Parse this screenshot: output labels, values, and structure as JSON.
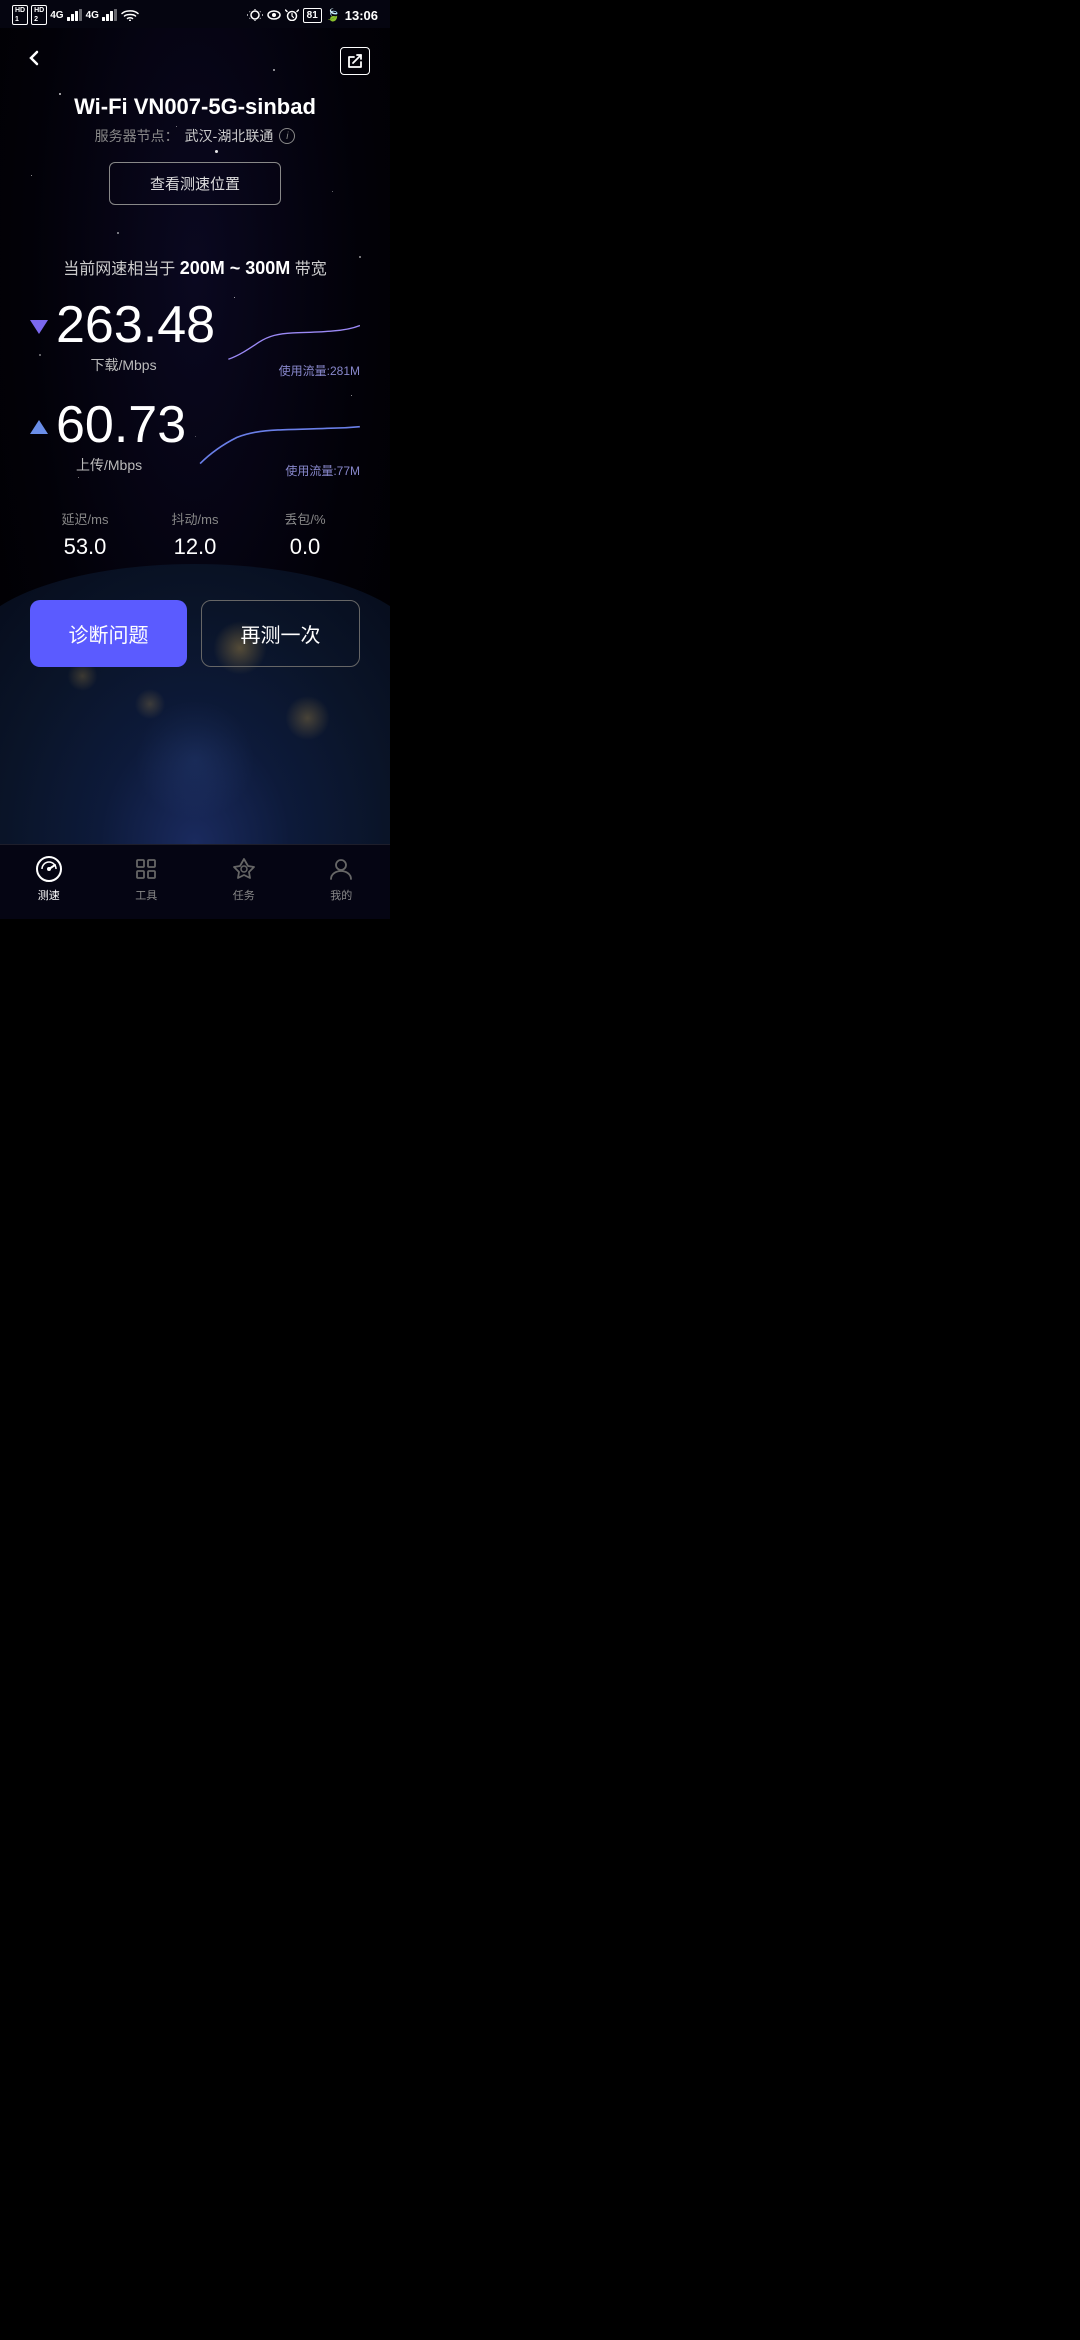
{
  "statusBar": {
    "left": {
      "hd1": "HD 1",
      "hd2": "HD 2",
      "signal1": "4G",
      "signal2": "4G",
      "wifi": "WiFi"
    },
    "right": {
      "battery": "81",
      "time": "13:06"
    }
  },
  "header": {
    "back_label": "‹",
    "share_icon": "share"
  },
  "connection": {
    "title": "Wi-Fi VN007-5G-sinbad",
    "server_label": "服务器节点：",
    "server_value": "武汉-湖北联通",
    "location_btn": "查看测速位置"
  },
  "speed_summary": {
    "prefix": "当前网速相当于",
    "range": "200M ~ 300M",
    "suffix": "带宽"
  },
  "download": {
    "value": "263.48",
    "unit": "下载/Mbps",
    "traffic": "使用流量:281M"
  },
  "upload": {
    "value": "60.73",
    "unit": "上传/Mbps",
    "traffic": "使用流量:77M"
  },
  "stats": {
    "latency_label": "延迟/ms",
    "latency_value": "53.0",
    "jitter_label": "抖动/ms",
    "jitter_value": "12.0",
    "packet_loss_label": "丢包/%",
    "packet_loss_value": "0.0"
  },
  "actions": {
    "diagnose": "诊断问题",
    "retest": "再测一次"
  },
  "bottom_nav": {
    "items": [
      {
        "label": "测速",
        "icon": "speedometer",
        "active": true
      },
      {
        "label": "工具",
        "icon": "tools",
        "active": false
      },
      {
        "label": "任务",
        "icon": "task",
        "active": false
      },
      {
        "label": "我的",
        "icon": "profile",
        "active": false
      }
    ]
  }
}
